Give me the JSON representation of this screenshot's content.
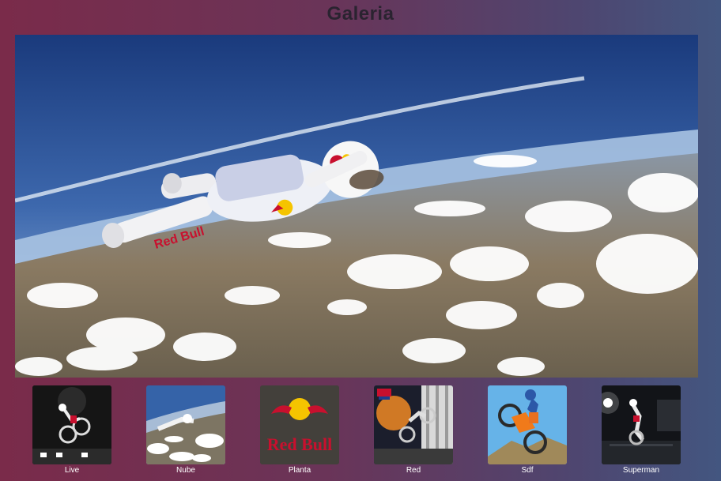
{
  "page": {
    "title": "Galeria"
  },
  "main_image": {
    "subject": "skydiver-photo",
    "brand_text": "Red Bull"
  },
  "thumbnails": [
    {
      "label": "Live",
      "subject": "bmx-rider-dark-stage"
    },
    {
      "label": "Nube",
      "subject": "skydiver-over-clouds"
    },
    {
      "label": "Planta",
      "subject": "red-bull-logo",
      "logo_text": "Red Bull"
    },
    {
      "label": "Red",
      "subject": "motocross-poster"
    },
    {
      "label": "Sdf",
      "subject": "motocross-jump-sky"
    },
    {
      "label": "Superman",
      "subject": "motocross-night-arena"
    }
  ],
  "colors": {
    "brand_red": "#c8102e",
    "brand_yellow": "#f5c400",
    "title": "#2a2330"
  }
}
